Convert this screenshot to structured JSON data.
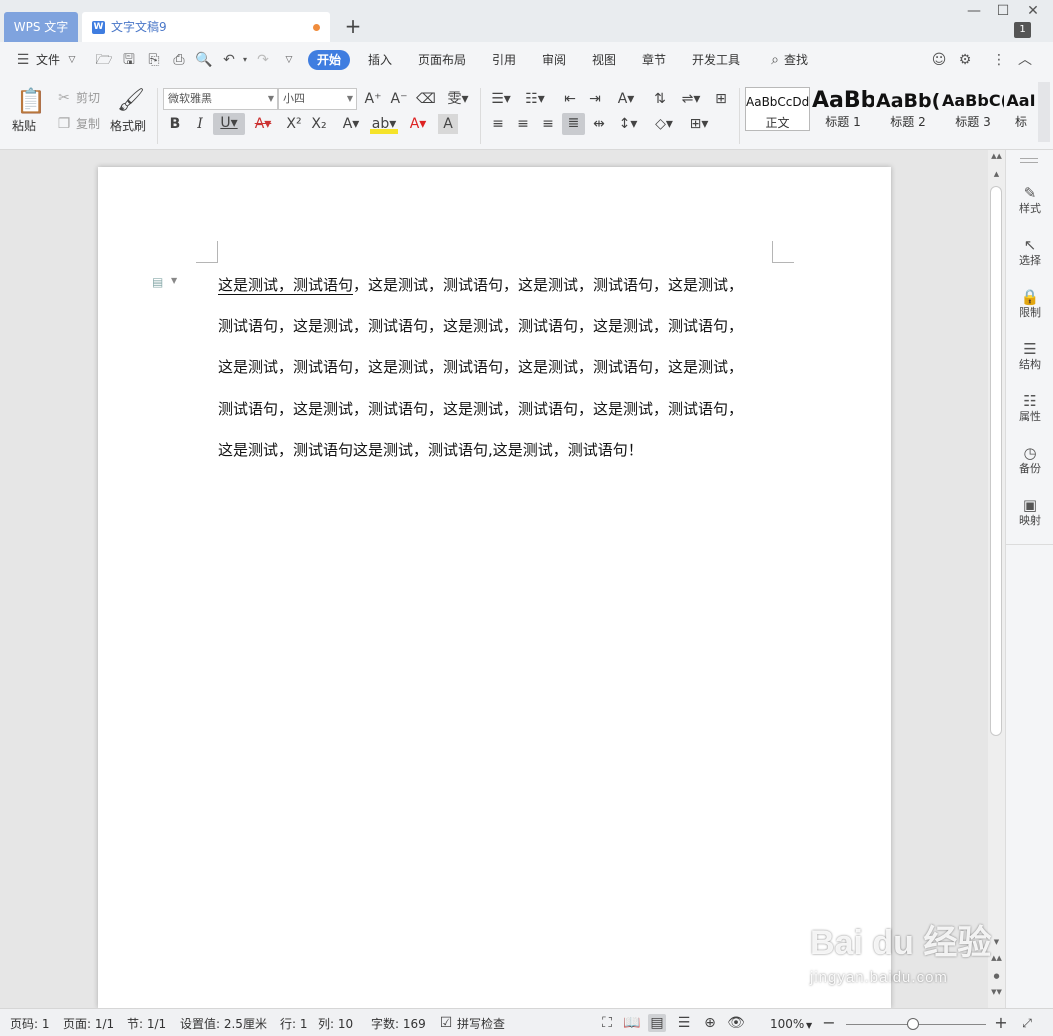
{
  "titlebar": {
    "app_tab": "WPS 文字",
    "doc_tab": "文字文稿9",
    "new_tab": "+",
    "badge": "1"
  },
  "menu": {
    "file": "文件",
    "items": [
      "开始",
      "插入",
      "页面布局",
      "引用",
      "审阅",
      "视图",
      "章节",
      "开发工具"
    ],
    "search": "查找"
  },
  "ribbon": {
    "paste": "粘贴",
    "cut": "剪切",
    "copy": "复制",
    "format_painter": "格式刷",
    "font_name": "微软雅黑",
    "font_size": "小四",
    "styles": [
      {
        "sample": "AaBbCcDd",
        "name": "正文"
      },
      {
        "sample": "AaBb",
        "name": "标题 1"
      },
      {
        "sample": "AaBb(",
        "name": "标题 2"
      },
      {
        "sample": "AaBbC(",
        "name": "标题 3"
      },
      {
        "sample": "AaI",
        "name": "标"
      }
    ]
  },
  "document": {
    "lines": [
      {
        "underlined": "这是测试，测试语句",
        "rest": "，这是测试，测试语句，这是测试，测试语句，这是测试，"
      },
      {
        "underlined": "",
        "rest": "测试语句，这是测试，测试语句，这是测试，测试语句，这是测试，测试语句，"
      },
      {
        "underlined": "",
        "rest": "这是测试，测试语句，这是测试，测试语句，这是测试，测试语句，这是测试，"
      },
      {
        "underlined": "",
        "rest": "测试语句，这是测试，测试语句，这是测试，测试语句，这是测试，测试语句，"
      },
      {
        "underlined": "",
        "rest": "这是测试，测试语句这是测试，测试语句,这是测试，测试语句！"
      }
    ]
  },
  "sidepanel": [
    "样式",
    "选择",
    "限制",
    "结构",
    "属性",
    "备份",
    "映射"
  ],
  "status": {
    "page_code": "页码: 1",
    "page": "页面: 1/1",
    "section": "节: 1/1",
    "setting": "设置值: 2.5厘米",
    "row": "行: 1",
    "col": "列: 10",
    "words": "字数: 169",
    "spell": "拼写检查",
    "zoom": "100%"
  },
  "watermark": {
    "brand": "Bai du 经验",
    "url": "jingyan.baidu.com"
  },
  "colors": {
    "accent": "#3f7de0",
    "app_tab": "#7fa3de",
    "unsaved_dot": "#f08c3c"
  }
}
